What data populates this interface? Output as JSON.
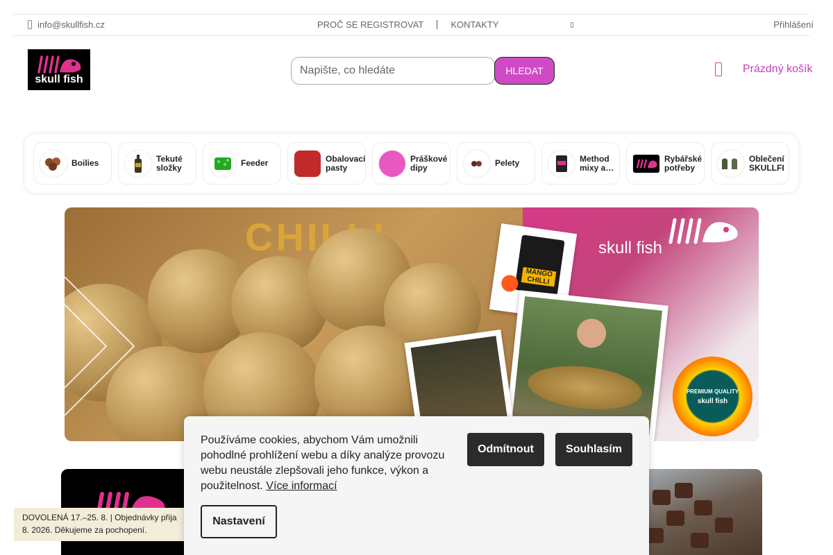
{
  "topbar": {
    "email": "info@skullfish.cz",
    "nav": [
      "PROČ SE REGISTROVAT",
      "KONTAKTY"
    ],
    "login": "Přihlášení"
  },
  "header": {
    "logo_text": "skull fish",
    "search_placeholder": "Napište, co hledáte",
    "search_button": "HLEDAT",
    "cart_label": "Prázdný košík"
  },
  "categories": [
    {
      "label": "Boilies",
      "icon": "boilies-icon"
    },
    {
      "label": "Tekuté\nsložky",
      "icon": "bottle-icon"
    },
    {
      "label": "Feeder",
      "icon": "feeder-icon"
    },
    {
      "label": "Obalovací\npasty",
      "icon": "paste-icon"
    },
    {
      "label": "Práškové\ndipy",
      "icon": "powder-icon"
    },
    {
      "label": "Pelety",
      "icon": "pellets-icon"
    },
    {
      "label": "Method\nmixy a…",
      "icon": "method-mix-icon"
    },
    {
      "label": "Rybářské\npotřeby",
      "icon": "fishing-gear-icon"
    },
    {
      "label": "Oblečení\nSKULLFI",
      "icon": "clothing-icon"
    }
  ],
  "hero": {
    "brand": "skull fish",
    "product_label": "MANGO CHILLI",
    "bg_text": "CHILLI",
    "badge_top": "PREMIUM QUALITY",
    "badge_brand": "skull fish"
  },
  "notice": {
    "text": "DOVOLENÁ 17.–25. 8. | Objednávky přija\n8. 2026. Děkujeme za pochopení."
  },
  "cookie": {
    "text": "Používáme cookies, abychom Vám umožnili pohodlné prohlížení webu a díky analýze provozu webu neustále zlepšovali jeho funkce, výkon a použitelnost.",
    "link": "Více informací",
    "decline": "Odmítnout",
    "accept": "Souhlasím",
    "settings": "Nastavení"
  },
  "colors": {
    "accent": "#d04ac6",
    "cart": "#c13fb8",
    "cookie_button": "#2b2b2b"
  }
}
